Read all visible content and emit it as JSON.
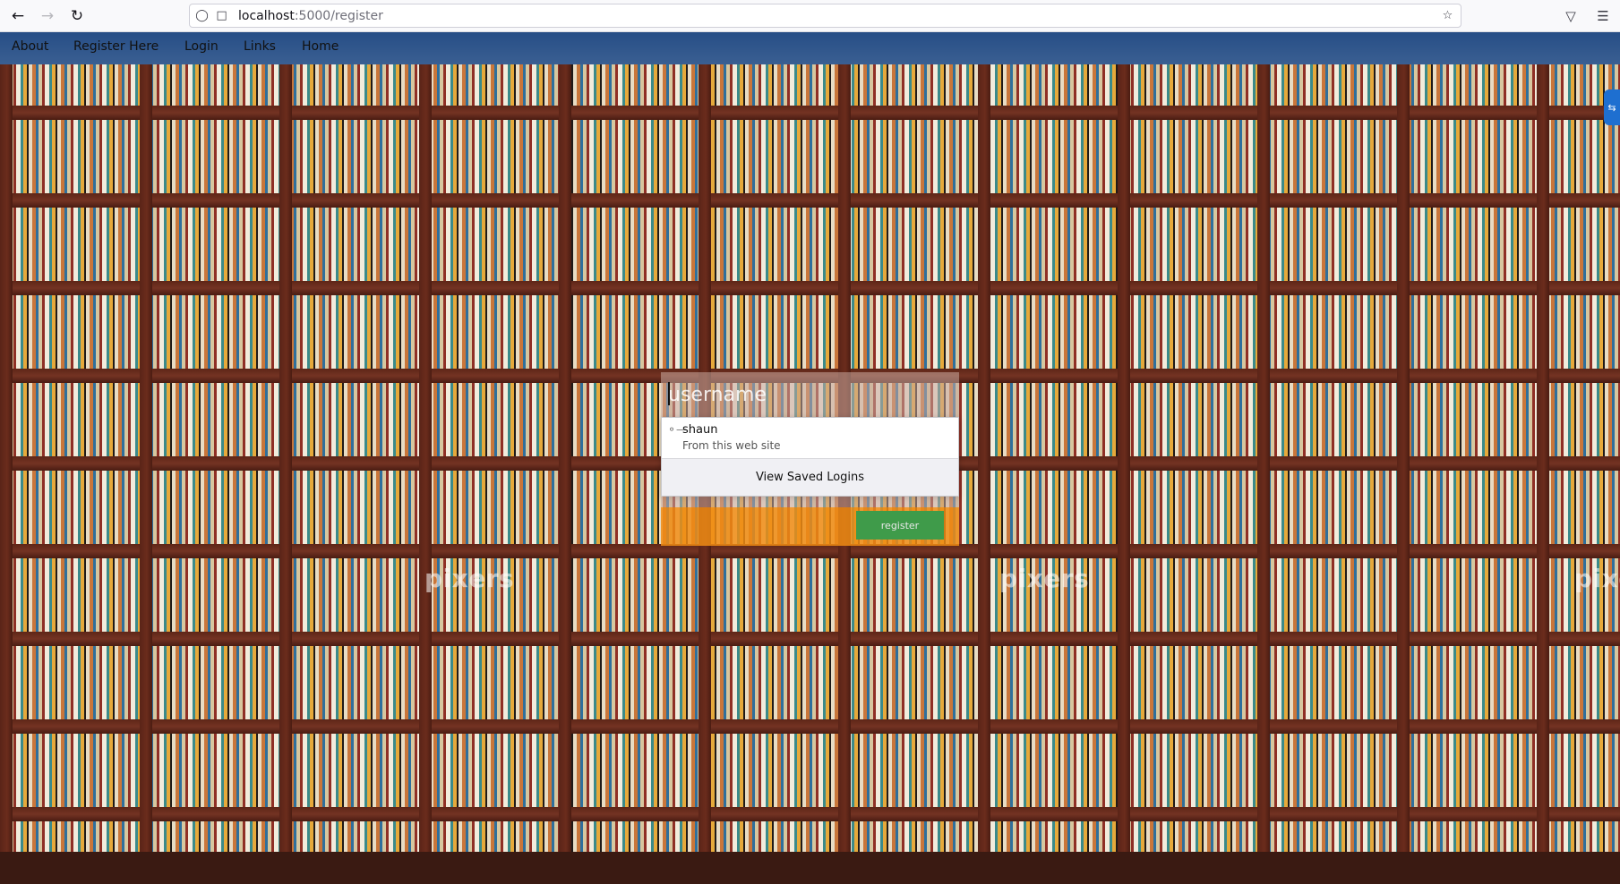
{
  "browser": {
    "url_host": "localhost",
    "url_path": ":5000/register",
    "back_icon": "back-arrow-icon",
    "forward_icon": "forward-arrow-icon",
    "reload_icon": "reload-icon",
    "shield_icon": "tracking-shield-icon",
    "page_icon": "page-icon",
    "bookmark_icon": "bookmark-star-icon",
    "pocket_icon": "pocket-icon",
    "menu_icon": "hamburger-menu-icon"
  },
  "nav": {
    "items": [
      {
        "label": "About"
      },
      {
        "label": "Register Here"
      },
      {
        "label": "Login"
      },
      {
        "label": "Links"
      },
      {
        "label": "Home"
      }
    ]
  },
  "background": {
    "watermark": "pixers"
  },
  "form": {
    "username_placeholder": "username",
    "register_label": "register"
  },
  "autocomplete": {
    "saved_user": "shaun",
    "origin": "From this web site",
    "view_saved": "View Saved Logins"
  },
  "colors": {
    "nav_bg": "#2f568c",
    "form_footer": "#f08c14",
    "register_button": "#3f9b4a",
    "side_tab": "#1e6fd0"
  }
}
